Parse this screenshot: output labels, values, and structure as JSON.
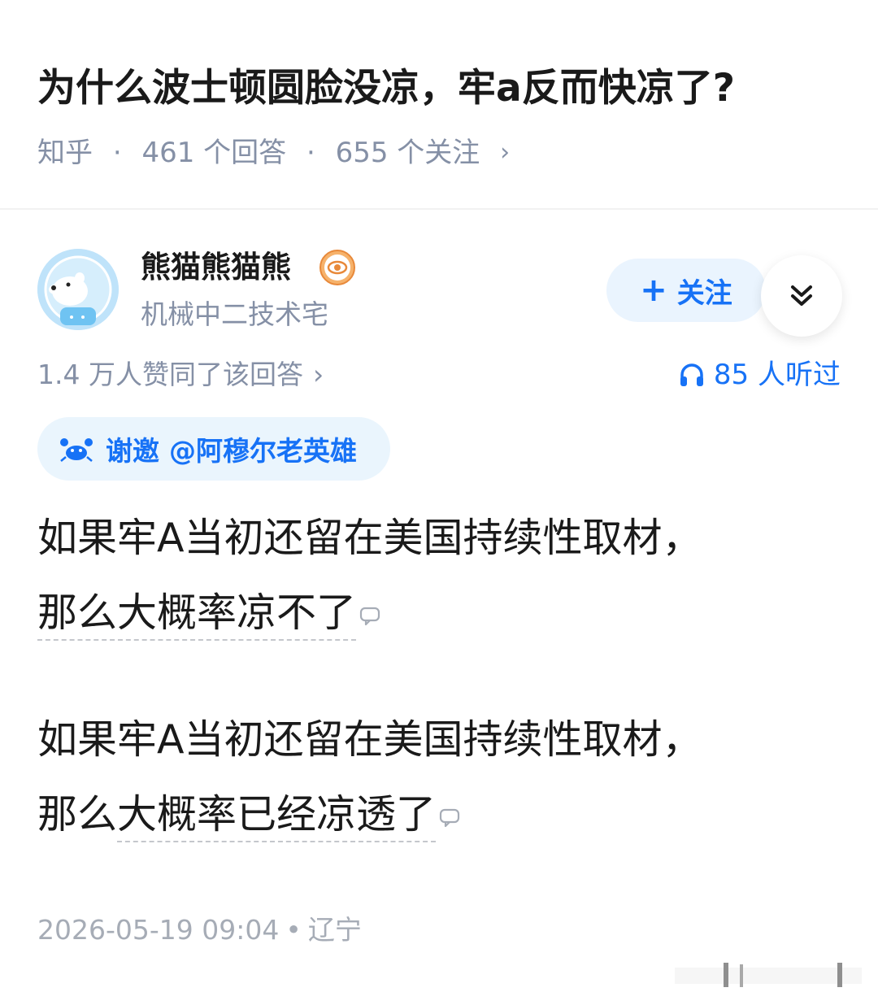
{
  "question": {
    "title": "为什么波士顿圆脸没凉，牢a反而快凉了?",
    "source": "知乎",
    "answers_count": "461 个回答",
    "followers_count": "655 个关注",
    "chevron": "›"
  },
  "author": {
    "name": "熊猫熊猫熊",
    "bio": "机械中二技术宅",
    "avatar_icon": "polar-bear-astronaut-avatar",
    "badge_icon": "eye-badge-icon"
  },
  "actions": {
    "follow_plus": "+",
    "follow_label": "关注",
    "expand_icon": "double-chevron-down-icon"
  },
  "stats": {
    "upvote_text": "1.4 万人赞同了该回答",
    "upvote_chevron": "›",
    "listen_text": "85 人听过"
  },
  "invite": {
    "label": "谢邀",
    "user": "@阿穆尔老英雄"
  },
  "content": {
    "p1_line1": "如果牢A当初还留在美国持续性取材，",
    "p1_line2": "那么大概率凉不了",
    "p2_line1": "如果牢A当初还留在美国持续性取材，",
    "p2_line2_start": "那么",
    "p2_line2_underlined": "大概率已经凉透了"
  },
  "footer": {
    "datetime": "2026-05-19 09:04",
    "separator": "•",
    "location": "辽宁"
  },
  "colors": {
    "accent": "#1772f6",
    "muted": "#8590a6",
    "text": "#1a1a1a"
  }
}
